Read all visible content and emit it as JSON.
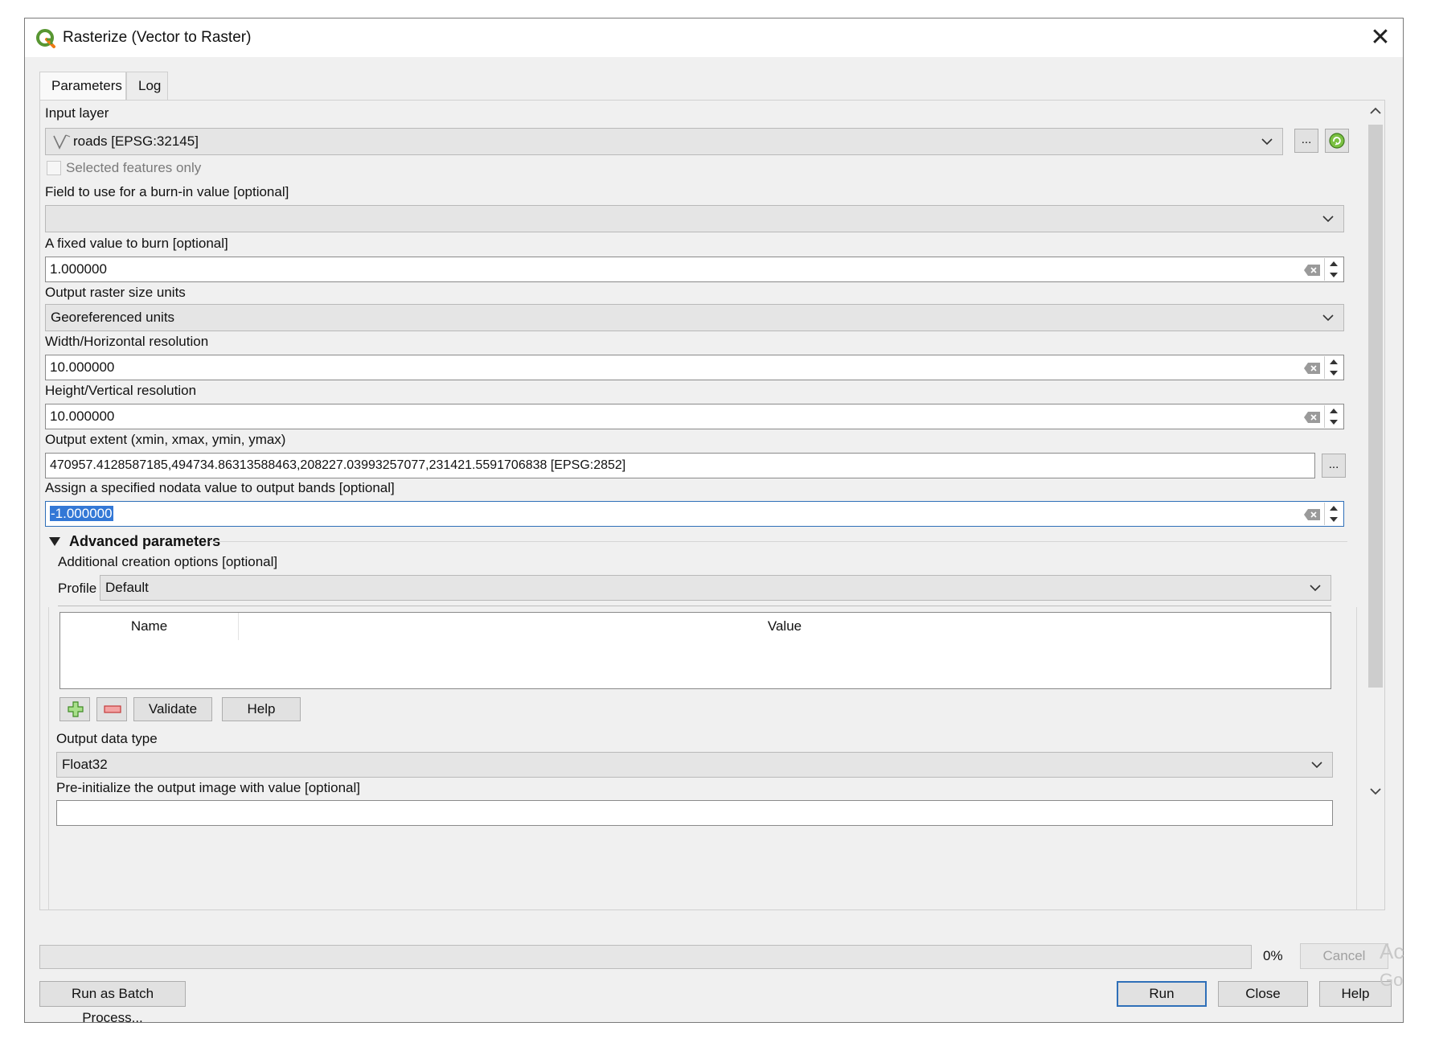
{
  "window": {
    "title": "Rasterize (Vector to Raster)"
  },
  "tabs": [
    {
      "label": "Parameters",
      "active": true
    },
    {
      "label": "Log",
      "active": false
    }
  ],
  "params": {
    "input_layer": {
      "label": "Input layer",
      "value": "roads [EPSG:32145]",
      "browse_label": "...",
      "selected_only_label": "Selected features only",
      "selected_only_checked": false
    },
    "burn_field": {
      "label": "Field to use for a burn-in value [optional]",
      "value": ""
    },
    "fixed_value": {
      "label": "A fixed value to burn [optional]",
      "value": "1.000000"
    },
    "units": {
      "label": "Output raster size units",
      "value": "Georeferenced units"
    },
    "width_res": {
      "label": "Width/Horizontal resolution",
      "value": "10.000000"
    },
    "height_res": {
      "label": "Height/Vertical resolution",
      "value": "10.000000"
    },
    "extent": {
      "label": "Output extent (xmin, xmax, ymin, ymax)",
      "value": "470957.4128587185,494734.86313588463,208227.03993257077,231421.5591706838 [EPSG:2852]",
      "browse_label": "..."
    },
    "nodata": {
      "label": "Assign a specified nodata value to output bands [optional]",
      "value": "-1.000000"
    }
  },
  "advanced": {
    "header": "Advanced parameters",
    "creation_options_label": "Additional creation options [optional]",
    "profile_label": "Profile",
    "profile_value": "Default",
    "table_columns": [
      "Name",
      "Value"
    ],
    "validate_label": "Validate",
    "help_label": "Help",
    "data_type_label": "Output data type",
    "data_type_value": "Float32",
    "preinit_label": "Pre-initialize the output image with value [optional]"
  },
  "footer": {
    "progress_percent": 0,
    "progress_text": "0%",
    "cancel_label": "Cancel",
    "batch_label": "Run as Batch Process...",
    "run_label": "Run",
    "close_label": "Close",
    "help_label": "Help"
  },
  "watermark": {
    "line1": "Ac",
    "line2": "Go"
  }
}
